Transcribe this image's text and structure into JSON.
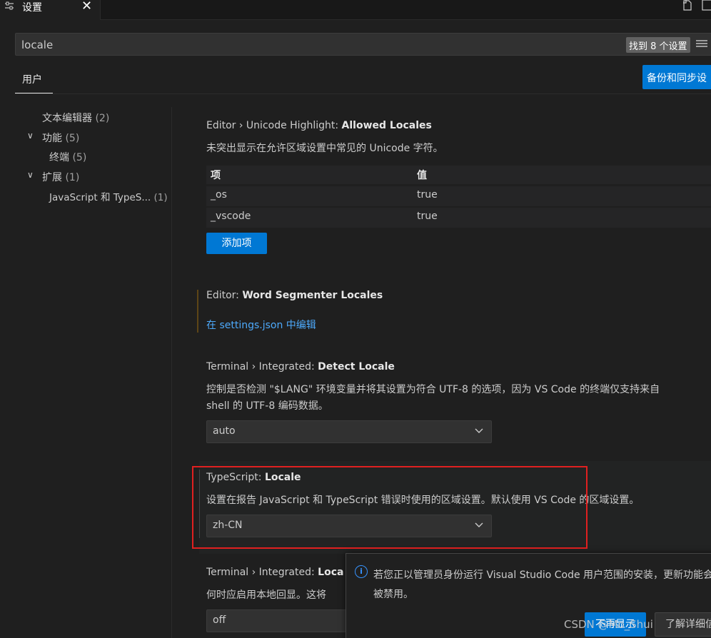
{
  "tab": {
    "icon": "settings-sliders-icon",
    "label": "设置",
    "close": "✕"
  },
  "toolbar": {
    "split_icon": "open-json-icon",
    "layout_icon": "split-editor-icon"
  },
  "search": {
    "value": "locale",
    "count": "找到 8 个设置",
    "filter_icon": "filter-list-icon"
  },
  "scope": {
    "user_tab": "用户",
    "sync_button": "备份和同步设"
  },
  "toc": [
    {
      "label": "文本编辑器",
      "count": "(2)"
    },
    {
      "label": "功能",
      "count": "(5)",
      "chevron": "∨"
    },
    {
      "label": "终端",
      "count": "(5)"
    },
    {
      "label": "扩展",
      "count": "(1)",
      "chevron": "∨"
    },
    {
      "label": "JavaScript 和 TypeS...",
      "count": "(1)"
    }
  ],
  "settings": {
    "s1": {
      "prefix": "Editor › Unicode Highlight: ",
      "name": "Allowed Locales",
      "desc": "未突出显示在允许区域设置中常见的 Unicode 字符。",
      "table": {
        "head": [
          "项",
          "值"
        ],
        "rows": [
          [
            "_os",
            "true"
          ],
          [
            "_vscode",
            "true"
          ]
        ]
      },
      "add_button": "添加项"
    },
    "s2": {
      "prefix": "Editor: ",
      "name": "Word Segmenter Locales",
      "link": "在 settings.json 中编辑"
    },
    "s3": {
      "prefix": "Terminal › Integrated: ",
      "name": "Detect Locale",
      "desc1": "控制是否检测 \"$LANG\" 环境变量并将其设置为符合 UTF-8 的选项，因为 VS Code 的终端仅支持来自",
      "desc2": "shell 的 UTF-8 编码数据。",
      "value": "auto"
    },
    "s4": {
      "prefix": "TypeScript: ",
      "name": "Locale",
      "desc": "设置在报告 JavaScript 和 TypeScript 错误时使用的区域设置。默认使用 VS Code 的区域设置。",
      "value": "zh-CN"
    },
    "s5": {
      "prefix": "Terminal › Integrated: ",
      "name": "Loca",
      "desc": "何时应启用本地回显。这将",
      "value": "off"
    }
  },
  "toast": {
    "icon": "info-icon",
    "text": "若您正以管理员身份运行 Visual Studio Code 用户范围的安装，更新功能会被禁用。",
    "button1": "不再显示",
    "button2": "了解详细信"
  },
  "watermark": "CSDN @Mo_Shui"
}
